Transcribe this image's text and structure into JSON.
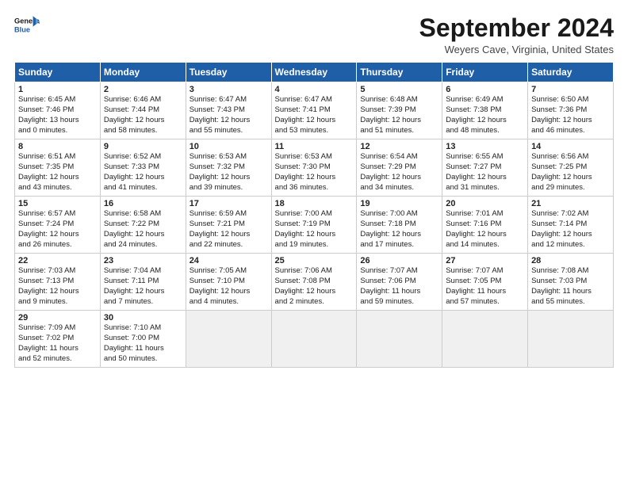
{
  "logo": {
    "line1": "General",
    "line2": "Blue"
  },
  "title": "September 2024",
  "subtitle": "Weyers Cave, Virginia, United States",
  "days_of_week": [
    "Sunday",
    "Monday",
    "Tuesday",
    "Wednesday",
    "Thursday",
    "Friday",
    "Saturday"
  ],
  "weeks": [
    [
      {
        "day": 1,
        "lines": [
          "Sunrise: 6:45 AM",
          "Sunset: 7:46 PM",
          "Daylight: 13 hours",
          "and 0 minutes."
        ]
      },
      {
        "day": 2,
        "lines": [
          "Sunrise: 6:46 AM",
          "Sunset: 7:44 PM",
          "Daylight: 12 hours",
          "and 58 minutes."
        ]
      },
      {
        "day": 3,
        "lines": [
          "Sunrise: 6:47 AM",
          "Sunset: 7:43 PM",
          "Daylight: 12 hours",
          "and 55 minutes."
        ]
      },
      {
        "day": 4,
        "lines": [
          "Sunrise: 6:47 AM",
          "Sunset: 7:41 PM",
          "Daylight: 12 hours",
          "and 53 minutes."
        ]
      },
      {
        "day": 5,
        "lines": [
          "Sunrise: 6:48 AM",
          "Sunset: 7:39 PM",
          "Daylight: 12 hours",
          "and 51 minutes."
        ]
      },
      {
        "day": 6,
        "lines": [
          "Sunrise: 6:49 AM",
          "Sunset: 7:38 PM",
          "Daylight: 12 hours",
          "and 48 minutes."
        ]
      },
      {
        "day": 7,
        "lines": [
          "Sunrise: 6:50 AM",
          "Sunset: 7:36 PM",
          "Daylight: 12 hours",
          "and 46 minutes."
        ]
      }
    ],
    [
      {
        "day": 8,
        "lines": [
          "Sunrise: 6:51 AM",
          "Sunset: 7:35 PM",
          "Daylight: 12 hours",
          "and 43 minutes."
        ]
      },
      {
        "day": 9,
        "lines": [
          "Sunrise: 6:52 AM",
          "Sunset: 7:33 PM",
          "Daylight: 12 hours",
          "and 41 minutes."
        ]
      },
      {
        "day": 10,
        "lines": [
          "Sunrise: 6:53 AM",
          "Sunset: 7:32 PM",
          "Daylight: 12 hours",
          "and 39 minutes."
        ]
      },
      {
        "day": 11,
        "lines": [
          "Sunrise: 6:53 AM",
          "Sunset: 7:30 PM",
          "Daylight: 12 hours",
          "and 36 minutes."
        ]
      },
      {
        "day": 12,
        "lines": [
          "Sunrise: 6:54 AM",
          "Sunset: 7:29 PM",
          "Daylight: 12 hours",
          "and 34 minutes."
        ]
      },
      {
        "day": 13,
        "lines": [
          "Sunrise: 6:55 AM",
          "Sunset: 7:27 PM",
          "Daylight: 12 hours",
          "and 31 minutes."
        ]
      },
      {
        "day": 14,
        "lines": [
          "Sunrise: 6:56 AM",
          "Sunset: 7:25 PM",
          "Daylight: 12 hours",
          "and 29 minutes."
        ]
      }
    ],
    [
      {
        "day": 15,
        "lines": [
          "Sunrise: 6:57 AM",
          "Sunset: 7:24 PM",
          "Daylight: 12 hours",
          "and 26 minutes."
        ]
      },
      {
        "day": 16,
        "lines": [
          "Sunrise: 6:58 AM",
          "Sunset: 7:22 PM",
          "Daylight: 12 hours",
          "and 24 minutes."
        ]
      },
      {
        "day": 17,
        "lines": [
          "Sunrise: 6:59 AM",
          "Sunset: 7:21 PM",
          "Daylight: 12 hours",
          "and 22 minutes."
        ]
      },
      {
        "day": 18,
        "lines": [
          "Sunrise: 7:00 AM",
          "Sunset: 7:19 PM",
          "Daylight: 12 hours",
          "and 19 minutes."
        ]
      },
      {
        "day": 19,
        "lines": [
          "Sunrise: 7:00 AM",
          "Sunset: 7:18 PM",
          "Daylight: 12 hours",
          "and 17 minutes."
        ]
      },
      {
        "day": 20,
        "lines": [
          "Sunrise: 7:01 AM",
          "Sunset: 7:16 PM",
          "Daylight: 12 hours",
          "and 14 minutes."
        ]
      },
      {
        "day": 21,
        "lines": [
          "Sunrise: 7:02 AM",
          "Sunset: 7:14 PM",
          "Daylight: 12 hours",
          "and 12 minutes."
        ]
      }
    ],
    [
      {
        "day": 22,
        "lines": [
          "Sunrise: 7:03 AM",
          "Sunset: 7:13 PM",
          "Daylight: 12 hours",
          "and 9 minutes."
        ]
      },
      {
        "day": 23,
        "lines": [
          "Sunrise: 7:04 AM",
          "Sunset: 7:11 PM",
          "Daylight: 12 hours",
          "and 7 minutes."
        ]
      },
      {
        "day": 24,
        "lines": [
          "Sunrise: 7:05 AM",
          "Sunset: 7:10 PM",
          "Daylight: 12 hours",
          "and 4 minutes."
        ]
      },
      {
        "day": 25,
        "lines": [
          "Sunrise: 7:06 AM",
          "Sunset: 7:08 PM",
          "Daylight: 12 hours",
          "and 2 minutes."
        ]
      },
      {
        "day": 26,
        "lines": [
          "Sunrise: 7:07 AM",
          "Sunset: 7:06 PM",
          "Daylight: 11 hours",
          "and 59 minutes."
        ]
      },
      {
        "day": 27,
        "lines": [
          "Sunrise: 7:07 AM",
          "Sunset: 7:05 PM",
          "Daylight: 11 hours",
          "and 57 minutes."
        ]
      },
      {
        "day": 28,
        "lines": [
          "Sunrise: 7:08 AM",
          "Sunset: 7:03 PM",
          "Daylight: 11 hours",
          "and 55 minutes."
        ]
      }
    ],
    [
      {
        "day": 29,
        "lines": [
          "Sunrise: 7:09 AM",
          "Sunset: 7:02 PM",
          "Daylight: 11 hours",
          "and 52 minutes."
        ]
      },
      {
        "day": 30,
        "lines": [
          "Sunrise: 7:10 AM",
          "Sunset: 7:00 PM",
          "Daylight: 11 hours",
          "and 50 minutes."
        ]
      },
      null,
      null,
      null,
      null,
      null
    ]
  ]
}
